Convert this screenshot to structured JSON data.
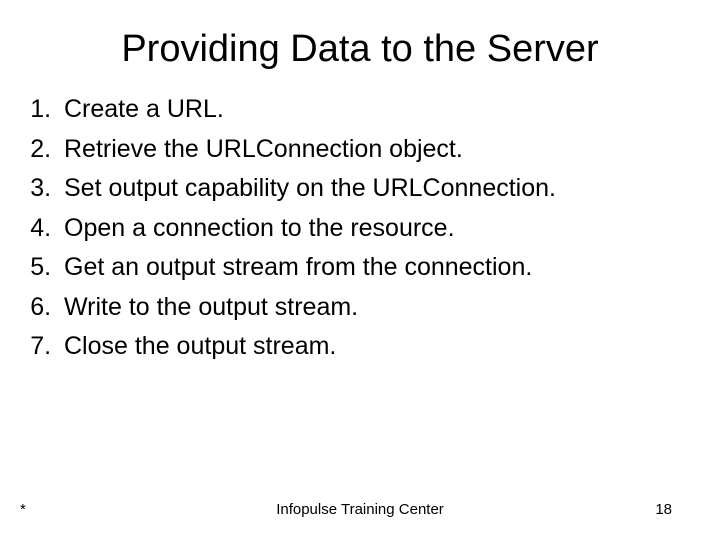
{
  "title": "Providing Data to the Server",
  "items": [
    "Create a URL.",
    "Retrieve the URLConnection object.",
    "Set output capability on the URLConnection.",
    "Open a connection to the resource.",
    "Get an output stream from the connection.",
    "Write to the output stream.",
    "Close the output stream."
  ],
  "footer": {
    "left": "*",
    "center": "Infopulse Training Center",
    "page": "18"
  }
}
